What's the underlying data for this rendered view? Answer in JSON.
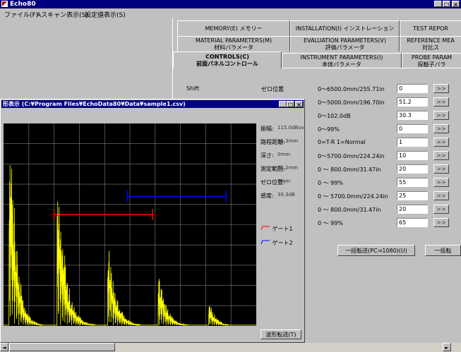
{
  "app": {
    "title": "Echo80",
    "controls": {
      "minimize": "_",
      "maximize": "□",
      "close": "×"
    }
  },
  "menu": [
    "ファイル(F)",
    "Aスキャン表示(S)",
    "設定値表示(S)"
  ],
  "tabs": {
    "row1": [
      {
        "label": "MEMORY(E) メモリー"
      },
      {
        "label": "INSTALLATION(I) インストレーション"
      },
      {
        "label": "TEST REPOR"
      }
    ],
    "row2": [
      {
        "label": "MATERIAL PARAMETERS(M)",
        "sub": "材料パラメータ"
      },
      {
        "label": "EVALUATION PARAMETERS(V)",
        "sub": "評価パラメータ"
      },
      {
        "label": "REFERENCE MEA",
        "sub": "対比ス"
      }
    ],
    "row3": [
      {
        "label": "CONTROLS(C)",
        "sub": "前面パネルコントロール",
        "active": true
      },
      {
        "label": "INSTRUMENT PARAMETERS(I)",
        "sub": "本体パラメータ"
      },
      {
        "label": "PROBE PARAM",
        "sub": "探触子パラ"
      }
    ]
  },
  "controls_panel": {
    "labels": {
      "shift": "Shift",
      "zero": "ゼロ位置"
    },
    "rows": [
      {
        "range": "0～6500.0mm/255.71in",
        "value": "0"
      },
      {
        "range": "0～5000.0mm/196.70in",
        "value": "51.2"
      },
      {
        "range": "0～102.0dB",
        "value": "30.3"
      },
      {
        "range": "0～99%",
        "value": "0"
      },
      {
        "range": "0=T-R 1=Normal",
        "value": "1"
      },
      {
        "range": "0～5700.0mm/224.24in",
        "value": "10"
      },
      {
        "range": "0 ～ 800.0mm/31.47in",
        "value": "20"
      },
      {
        "range": "0 ～ 99%",
        "value": "55"
      },
      {
        "range": "0 ～ 5700.0mm/224.24in",
        "value": "25"
      },
      {
        "range": "0 ～ 800.0mm/31.47in",
        "value": "20"
      },
      {
        "range": "0 ～ 99%",
        "value": "65"
      }
    ],
    "row_button_label": ">>",
    "transfer_button": "一括転送(PC⇒1080)(U)",
    "transfer_button2": "一括転"
  },
  "wave_window": {
    "title": "形表示 (C:¥Program Files¥EchoData80¥Data¥sample1.csv)",
    "readouts": [
      {
        "label": "振幅:",
        "value": "115.0dBuv"
      },
      {
        "label": "路程距離:",
        "value": "11.3mm"
      },
      {
        "label": "深さ:",
        "value": "0mm"
      },
      {
        "label": "測定範囲:",
        "value": "51.2mm"
      },
      {
        "label": "ゼロ位置:",
        "value": "0mm"
      },
      {
        "label": "感度:",
        "value": "30.3dB"
      }
    ],
    "gates": [
      {
        "label": "ゲート1",
        "color": "#ff0000"
      },
      {
        "label": "ゲート2",
        "color": "#0000ff"
      }
    ],
    "send_button": "波形転送(T)"
  },
  "chart_data": {
    "type": "line",
    "title": "",
    "xlabel": "",
    "ylabel": "",
    "xlim": [
      0,
      100
    ],
    "ylim": [
      0,
      100
    ],
    "grid": true,
    "gridlines": {
      "x": 10,
      "y": 10
    },
    "series": [
      {
        "color": "#ffff00",
        "echoes": [
          {
            "x": 3,
            "peak": 100,
            "decay": 2.5
          },
          {
            "x": 22,
            "peak": 74,
            "decay": 3.0
          },
          {
            "x": 42,
            "peak": 38,
            "decay": 3.0
          },
          {
            "x": 62,
            "peak": 24,
            "decay": 3.0
          },
          {
            "x": 82,
            "peak": 11,
            "decay": 2.5
          }
        ]
      }
    ],
    "gates": [
      {
        "name": "gate1",
        "color": "#ff0000",
        "start": 20,
        "end": 59,
        "level": 55
      },
      {
        "name": "gate2",
        "color": "#0000ff",
        "start": 49,
        "end": 88,
        "level": 64
      }
    ]
  }
}
